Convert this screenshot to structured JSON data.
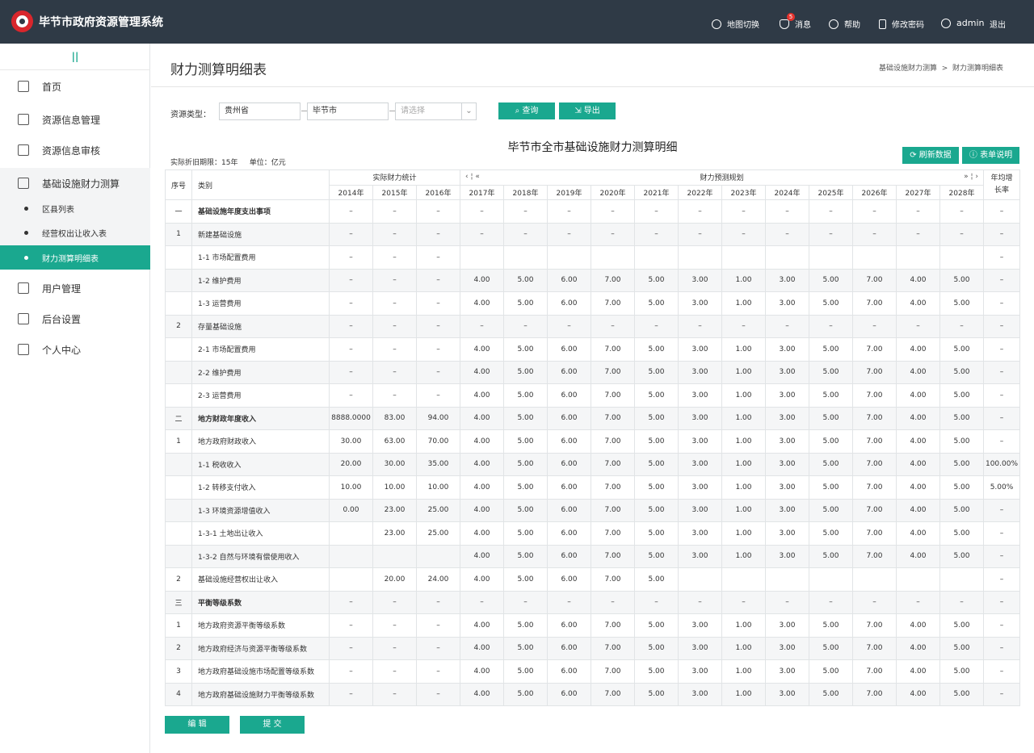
{
  "app": {
    "title": "毕节市政府资源管理系统"
  },
  "topnav": {
    "map": "地图切换",
    "msg": "消息",
    "msg_count": "5",
    "help": "帮助",
    "pwd": "修改密码",
    "user": "admin",
    "logout": "退出"
  },
  "sidebar": {
    "toggle": "||",
    "home": "首页",
    "resinfo": "资源信息管理",
    "audit": "资源信息审核",
    "infra": "基础设施财力测算",
    "sub1": "区县列表",
    "sub2": "经营权出让收入表",
    "sub3": "财力测算明细表",
    "users": "用户管理",
    "settings": "后台设置",
    "personal": "个人中心"
  },
  "page": {
    "title": "财力测算明细表",
    "crumb1": "基础设施财力测算",
    "crumb_sep": ">",
    "crumb2": "财力测算明细表"
  },
  "filter": {
    "label": "资源类型：",
    "province": "贵州省",
    "city": "毕节市",
    "placeholder": "请选择",
    "query": "查询",
    "export": "导出"
  },
  "table": {
    "title": "毕节市全市基础设施财力测算明细",
    "period": "实际折旧期限：15年",
    "unit": "单位：亿元",
    "refresh": "刷新数据",
    "explain": "表单说明",
    "h_seq": "序号",
    "h_cat": "类别",
    "h_actual": "实际财力统计",
    "h_forecast": "财力预测规划",
    "h_growth": "年均增长率",
    "years": [
      "2014年",
      "2015年",
      "2016年",
      "2017年",
      "2018年",
      "2019年",
      "2020年",
      "2021年",
      "2022年",
      "2023年",
      "2024年",
      "2025年",
      "2026年",
      "2027年",
      "2028年"
    ],
    "rows": [
      {
        "seq": "一",
        "name": "基础设施年度支出事项",
        "bold": true,
        "v": [
          "–",
          "–",
          "–",
          "–",
          "–",
          "–",
          "–",
          "–",
          "–",
          "–",
          "–",
          "–",
          "–",
          "–",
          "–"
        ],
        "g": "–"
      },
      {
        "seq": "1",
        "name": "新建基础设施",
        "v": [
          "–",
          "–",
          "–",
          "–",
          "–",
          "–",
          "–",
          "–",
          "–",
          "–",
          "–",
          "–",
          "–",
          "–",
          "–"
        ],
        "g": "–"
      },
      {
        "seq": "",
        "name": "1-1 市场配置费用",
        "v": [
          "–",
          "–",
          "–",
          "",
          "",
          "",
          "",
          "",
          "",
          "",
          "",
          "",
          "",
          "",
          ""
        ],
        "g": "–"
      },
      {
        "seq": "",
        "name": "1-2 维护费用",
        "v": [
          "–",
          "–",
          "–",
          "4.00",
          "5.00",
          "6.00",
          "7.00",
          "5.00",
          "3.00",
          "1.00",
          "3.00",
          "5.00",
          "7.00",
          "4.00",
          "5.00"
        ],
        "g": "–"
      },
      {
        "seq": "",
        "name": "1-3 运营费用",
        "v": [
          "–",
          "–",
          "–",
          "4.00",
          "5.00",
          "6.00",
          "7.00",
          "5.00",
          "3.00",
          "1.00",
          "3.00",
          "5.00",
          "7.00",
          "4.00",
          "5.00"
        ],
        "g": "–"
      },
      {
        "seq": "2",
        "name": "存量基础设施",
        "v": [
          "–",
          "–",
          "–",
          "–",
          "–",
          "–",
          "–",
          "–",
          "–",
          "–",
          "–",
          "–",
          "–",
          "–",
          "–"
        ],
        "g": "–"
      },
      {
        "seq": "",
        "name": "2-1 市场配置费用",
        "v": [
          "–",
          "–",
          "–",
          "4.00",
          "5.00",
          "6.00",
          "7.00",
          "5.00",
          "3.00",
          "1.00",
          "3.00",
          "5.00",
          "7.00",
          "4.00",
          "5.00"
        ],
        "g": "–"
      },
      {
        "seq": "",
        "name": "2-2 维护费用",
        "v": [
          "–",
          "–",
          "–",
          "4.00",
          "5.00",
          "6.00",
          "7.00",
          "5.00",
          "3.00",
          "1.00",
          "3.00",
          "5.00",
          "7.00",
          "4.00",
          "5.00"
        ],
        "g": "–"
      },
      {
        "seq": "",
        "name": "2-3 运营费用",
        "v": [
          "–",
          "–",
          "–",
          "4.00",
          "5.00",
          "6.00",
          "7.00",
          "5.00",
          "3.00",
          "1.00",
          "3.00",
          "5.00",
          "7.00",
          "4.00",
          "5.00"
        ],
        "g": "–"
      },
      {
        "seq": "二",
        "name": "地方财政年度收入",
        "bold": true,
        "v": [
          "8888.0000",
          "83.00",
          "94.00",
          "4.00",
          "5.00",
          "6.00",
          "7.00",
          "5.00",
          "3.00",
          "1.00",
          "3.00",
          "5.00",
          "7.00",
          "4.00",
          "5.00"
        ],
        "g": "–"
      },
      {
        "seq": "1",
        "name": "地方政府财政收入",
        "v": [
          "30.00",
          "63.00",
          "70.00",
          "4.00",
          "5.00",
          "6.00",
          "7.00",
          "5.00",
          "3.00",
          "1.00",
          "3.00",
          "5.00",
          "7.00",
          "4.00",
          "5.00"
        ],
        "g": "–"
      },
      {
        "seq": "",
        "name": "1-1 税收收入",
        "v": [
          "20.00",
          "30.00",
          "35.00",
          "4.00",
          "5.00",
          "6.00",
          "7.00",
          "5.00",
          "3.00",
          "1.00",
          "3.00",
          "5.00",
          "7.00",
          "4.00",
          "5.00"
        ],
        "g": "100.00%"
      },
      {
        "seq": "",
        "name": "1-2 转移支付收入",
        "v": [
          "10.00",
          "10.00",
          "10.00",
          "4.00",
          "5.00",
          "6.00",
          "7.00",
          "5.00",
          "3.00",
          "1.00",
          "3.00",
          "5.00",
          "7.00",
          "4.00",
          "5.00"
        ],
        "g": "5.00%"
      },
      {
        "seq": "",
        "name": "1-3 环境资源增值收入",
        "v": [
          "0.00",
          "23.00",
          "25.00",
          "4.00",
          "5.00",
          "6.00",
          "7.00",
          "5.00",
          "3.00",
          "1.00",
          "3.00",
          "5.00",
          "7.00",
          "4.00",
          "5.00"
        ],
        "g": "–"
      },
      {
        "seq": "",
        "name": "1-3-1 土地出让收入",
        "v": [
          "",
          "23.00",
          "25.00",
          "4.00",
          "5.00",
          "6.00",
          "7.00",
          "5.00",
          "3.00",
          "1.00",
          "3.00",
          "5.00",
          "7.00",
          "4.00",
          "5.00"
        ],
        "g": "–"
      },
      {
        "seq": "",
        "name": "1-3-2 自然与环境有偿使用收入",
        "v": [
          "",
          "",
          "",
          "4.00",
          "5.00",
          "6.00",
          "7.00",
          "5.00",
          "3.00",
          "1.00",
          "3.00",
          "5.00",
          "7.00",
          "4.00",
          "5.00"
        ],
        "g": "–"
      },
      {
        "seq": "2",
        "name": "基础设施经营权出让收入",
        "v": [
          "",
          "20.00",
          "24.00",
          "4.00",
          "5.00",
          "6.00",
          "7.00",
          "5.00",
          "",
          "",
          "",
          "",
          "",
          "",
          ""
        ],
        "g": "–"
      },
      {
        "seq": "三",
        "name": "平衡等级系数",
        "bold": true,
        "v": [
          "–",
          "–",
          "–",
          "–",
          "–",
          "–",
          "–",
          "–",
          "–",
          "–",
          "–",
          "–",
          "–",
          "–",
          "–"
        ],
        "g": "–"
      },
      {
        "seq": "1",
        "name": "地方政府资源平衡等级系数",
        "v": [
          "–",
          "–",
          "–",
          "4.00",
          "5.00",
          "6.00",
          "7.00",
          "5.00",
          "3.00",
          "1.00",
          "3.00",
          "5.00",
          "7.00",
          "4.00",
          "5.00"
        ],
        "g": "–"
      },
      {
        "seq": "2",
        "name": "地方政府经济与资源平衡等级系数",
        "v": [
          "–",
          "–",
          "–",
          "4.00",
          "5.00",
          "6.00",
          "7.00",
          "5.00",
          "3.00",
          "1.00",
          "3.00",
          "5.00",
          "7.00",
          "4.00",
          "5.00"
        ],
        "g": "–"
      },
      {
        "seq": "3",
        "name": "地方政府基础设施市场配置等级系数",
        "v": [
          "–",
          "–",
          "–",
          "4.00",
          "5.00",
          "6.00",
          "7.00",
          "5.00",
          "3.00",
          "1.00",
          "3.00",
          "5.00",
          "7.00",
          "4.00",
          "5.00"
        ],
        "g": "–"
      },
      {
        "seq": "4",
        "name": "地方政府基础设施财力平衡等级系数",
        "v": [
          "–",
          "–",
          "–",
          "4.00",
          "5.00",
          "6.00",
          "7.00",
          "5.00",
          "3.00",
          "1.00",
          "3.00",
          "5.00",
          "7.00",
          "4.00",
          "5.00"
        ],
        "g": "–"
      }
    ]
  },
  "actions": {
    "edit": "编 辑",
    "submit": "提 交"
  }
}
